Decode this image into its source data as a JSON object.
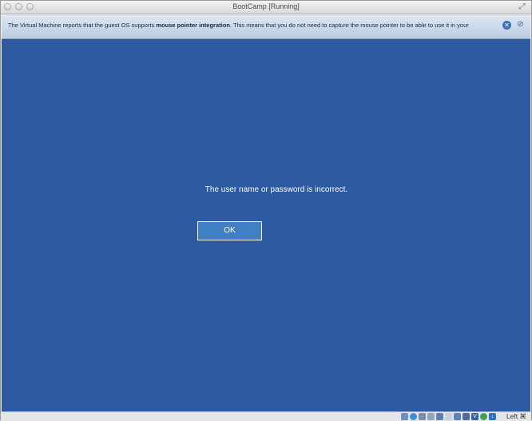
{
  "window": {
    "title": "BootCamp [Running]"
  },
  "notice": {
    "text_before": "The Virtual Machine reports that the guest OS supports ",
    "bold": "mouse pointer integration",
    "text_middle": ". This means that you do not need to ",
    "italic": "capture",
    "text_after": " the mouse pointer to be able to use it in your"
  },
  "vm_screen": {
    "message": "The user name or password is incorrect.",
    "ok_label": "OK",
    "background": "#2d5aa0"
  },
  "statusbar": {
    "icons": [
      "hard-disk-icon",
      "optical-disk-icon",
      "usb-icon",
      "shared-folders-icon",
      "network-icon",
      "display-icon",
      "video-capture-icon",
      "audio-icon",
      "virtualization-icon",
      "mouse-integration-icon",
      "download-icon"
    ],
    "host_key": "Left ⌘"
  }
}
